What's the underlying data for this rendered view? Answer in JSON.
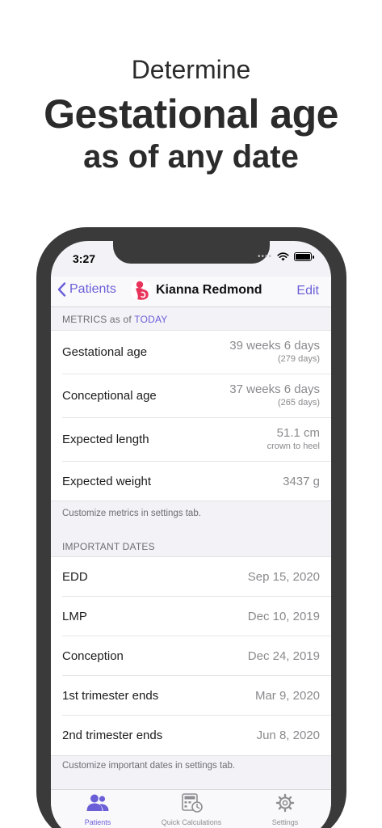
{
  "promo": {
    "line1": "Determine",
    "line2": "Gestational age",
    "line3": "as of any date"
  },
  "status": {
    "time": "3:27",
    "signal": "••••"
  },
  "nav": {
    "back_label": "Patients",
    "title": "Kianna Redmond",
    "edit_label": "Edit"
  },
  "metrics": {
    "header_prefix": "METRICS as of ",
    "header_date": "TODAY",
    "rows": [
      {
        "label": "Gestational age",
        "value": "39 weeks 6 days",
        "sub": "(279 days)"
      },
      {
        "label": "Conceptional age",
        "value": "37 weeks 6 days",
        "sub": "(265 days)"
      },
      {
        "label": "Expected length",
        "value": "51.1 cm",
        "sub": "crown to heel"
      },
      {
        "label": "Expected weight",
        "value": "3437 g",
        "sub": ""
      }
    ],
    "footer": "Customize metrics in settings tab."
  },
  "dates": {
    "header": "IMPORTANT DATES",
    "rows": [
      {
        "label": "EDD",
        "value": "Sep 15, 2020"
      },
      {
        "label": "LMP",
        "value": "Dec 10, 2019"
      },
      {
        "label": "Conception",
        "value": "Dec 24, 2019"
      },
      {
        "label": "1st trimester ends",
        "value": "Mar 9, 2020"
      },
      {
        "label": "2nd trimester ends",
        "value": "Jun 8, 2020"
      }
    ],
    "footer": "Customize important dates in settings tab."
  },
  "tabs": [
    {
      "label": "Patients",
      "icon": "patients-icon",
      "active": true
    },
    {
      "label": "Quick Calculations",
      "icon": "calculator-icon",
      "active": false
    },
    {
      "label": "Settings",
      "icon": "gear-icon",
      "active": false
    }
  ],
  "colors": {
    "accent": "#6b5fd8",
    "avatar": "#e8345a"
  }
}
